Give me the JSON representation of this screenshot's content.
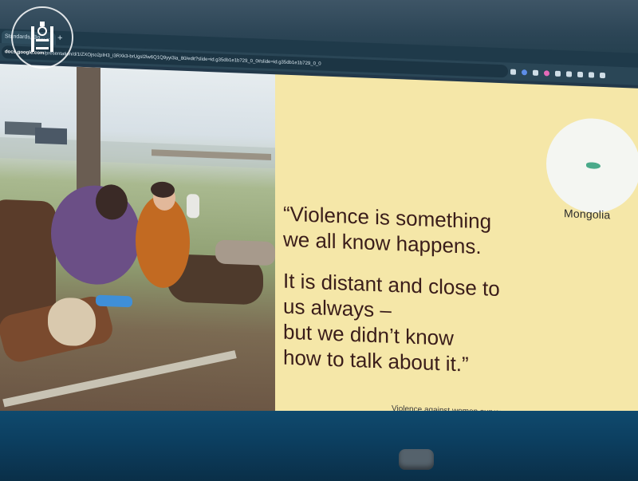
{
  "browser": {
    "tab_title": "Standards, Bo...",
    "url_host": "docs.google.com",
    "url_path": "/presentation/d/1IZXOjso2pIH3_i3RXk3-brUgsl2lw6Q1Q9yyi3ia_80/edit?slide=id.g35db1e1b729_0_0#slide=id.g35db1e1b729_0_0"
  },
  "slide": {
    "quote_part1": [
      "“Violence is something",
      "we all know happens."
    ],
    "quote_part2": [
      "It is distant and close to",
      "us always –",
      "but we didn’t know",
      "how to talk about it.”"
    ],
    "map_label": "Mongolia",
    "attribution": "Violence against women survey enumerator, Mongolia"
  },
  "colors": {
    "slide_panel": "#f5e7a8",
    "quote_text": "#3a1d1a",
    "map_highlight": "#4aaa8a",
    "browser_chrome": "#2a4656"
  }
}
